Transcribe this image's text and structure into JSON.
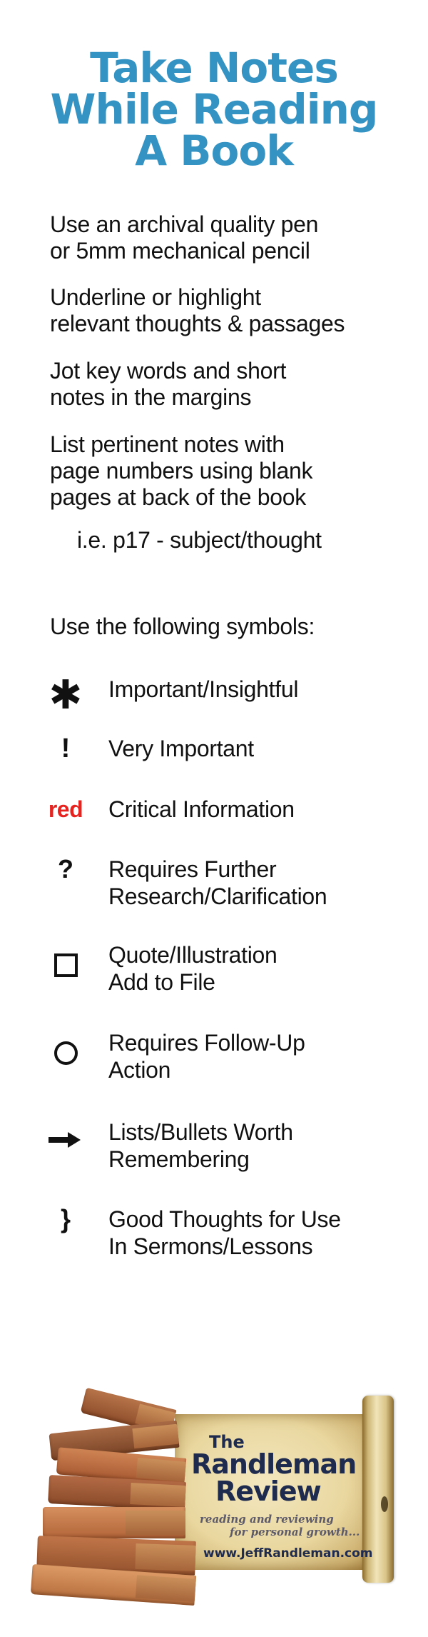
{
  "header": {
    "title_lines": [
      "Take Notes",
      "While Reading",
      "A Book"
    ],
    "title_color": "#3593c3"
  },
  "tips": [
    {
      "lines": [
        "Use an archival quality pen",
        "or 5mm mechanical pencil"
      ]
    },
    {
      "lines": [
        "Underline or highlight",
        "relevant thoughts & passages"
      ]
    },
    {
      "lines": [
        "Jot key words and short",
        "notes in the margins"
      ]
    },
    {
      "lines": [
        "List pertinent notes with",
        "page numbers using blank",
        "pages at back of the book"
      ]
    }
  ],
  "example": "i.e.  p17 - subject/thought",
  "symbols_heading": "Use the following symbols:",
  "symbols": [
    {
      "icon": "asterisk-icon",
      "glyph": "✱",
      "lines": [
        "Important/Insightful"
      ]
    },
    {
      "icon": "exclamation-icon",
      "glyph": "!",
      "lines": [
        "Very Important"
      ]
    },
    {
      "icon": "red-text-marker",
      "glyph": "red",
      "lines": [
        "Critical Information"
      ]
    },
    {
      "icon": "question-icon",
      "glyph": "?",
      "lines": [
        "Requires Further",
        "Research/Clarification"
      ]
    },
    {
      "icon": "square-icon",
      "glyph": "",
      "lines": [
        "Quote/Illustration",
        "Add to File"
      ]
    },
    {
      "icon": "circle-icon",
      "glyph": "",
      "lines": [
        "Requires Follow-Up",
        "Action"
      ]
    },
    {
      "icon": "arrow-right-icon",
      "glyph": "",
      "lines": [
        "Lists/Bullets Worth",
        "Remembering"
      ]
    },
    {
      "icon": "brace-icon",
      "glyph": "}",
      "lines": [
        "Good Thoughts for Use",
        "In Sermons/Lessons"
      ]
    }
  ],
  "colors": {
    "red_marker": "#e6231f",
    "brand_navy": "#1e2a4e",
    "tagline_gray": "#5d5a6a"
  },
  "logo": {
    "the": "The",
    "name": "Randleman",
    "review": "Review",
    "tagline_1": "reading and reviewing",
    "tagline_2": "for personal growth...",
    "url": "www.JeffRandleman.com"
  }
}
